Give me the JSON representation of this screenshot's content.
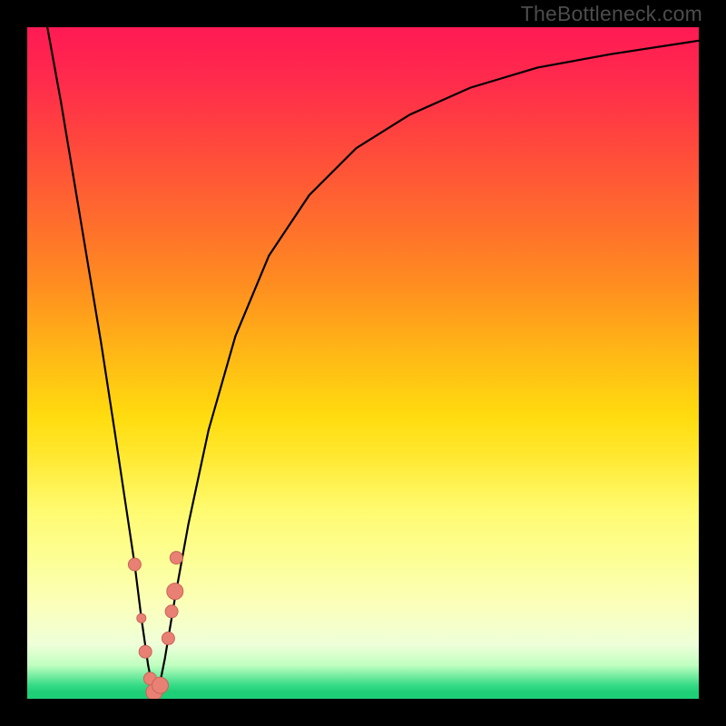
{
  "watermark": "TheBottleneck.com",
  "chart_data": {
    "type": "line",
    "title": "",
    "xlabel": "",
    "ylabel": "",
    "xlim": [
      0,
      100
    ],
    "ylim": [
      0,
      100
    ],
    "grid": false,
    "legend": false,
    "background": {
      "type": "vertical-gradient",
      "stops": [
        {
          "pos": 0.0,
          "color": "#ff1a54"
        },
        {
          "pos": 0.15,
          "color": "#ff4040"
        },
        {
          "pos": 0.38,
          "color": "#ff8c20"
        },
        {
          "pos": 0.58,
          "color": "#ffdc0f"
        },
        {
          "pos": 0.8,
          "color": "#fcff99"
        },
        {
          "pos": 0.95,
          "color": "#c0ffc0"
        },
        {
          "pos": 1.0,
          "color": "#1fcf78"
        }
      ]
    },
    "series": [
      {
        "name": "bottleneck-curve",
        "color": "#000000",
        "x": [
          3,
          5,
          7,
          9,
          11,
          13,
          14.5,
          16,
          17,
          18,
          18.8,
          19.5,
          20.5,
          22,
          24,
          27,
          31,
          36,
          42,
          49,
          57,
          66,
          76,
          87,
          100
        ],
        "y": [
          100,
          89,
          77,
          65,
          53,
          40,
          30,
          20,
          12,
          5,
          1,
          1,
          6,
          15,
          26,
          40,
          54,
          66,
          75,
          82,
          87,
          91,
          94,
          96,
          98
        ]
      }
    ],
    "points": {
      "name": "datapoints",
      "color": "#e98074",
      "stroke": "#c96458",
      "x": [
        16.0,
        17.0,
        17.6,
        18.3,
        18.9,
        19.8,
        21.0,
        21.5,
        22.0,
        22.2
      ],
      "y": [
        20.0,
        12.0,
        7.0,
        3.0,
        1.0,
        2.0,
        9.0,
        13.0,
        16.0,
        21.0
      ],
      "r": [
        7,
        5,
        7,
        7,
        9,
        9,
        7,
        7,
        9,
        7
      ]
    }
  }
}
